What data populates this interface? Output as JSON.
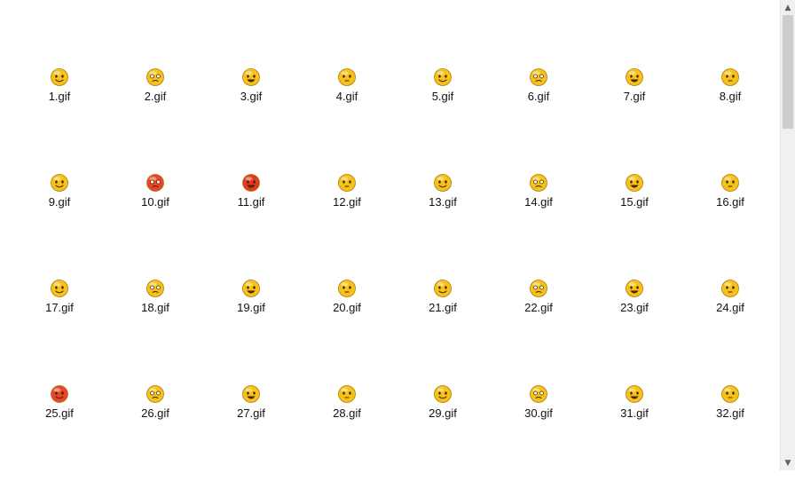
{
  "files": [
    {
      "name": "1.gif",
      "icon": "smiley-tongue-wink-icon",
      "face": "#f6c21a"
    },
    {
      "name": "2.gif",
      "icon": "smiley-worried-icon",
      "face": "#f6c21a"
    },
    {
      "name": "3.gif",
      "icon": "smiley-heart-eyes-icon",
      "face": "#f6c21a"
    },
    {
      "name": "4.gif",
      "icon": "smiley-grin-icon",
      "face": "#f6c21a"
    },
    {
      "name": "5.gif",
      "icon": "smiley-sunglasses-icon",
      "face": "#f6c21a"
    },
    {
      "name": "6.gif",
      "icon": "smiley-shy-icon",
      "face": "#f6c21a"
    },
    {
      "name": "7.gif",
      "icon": "smiley-surprised-icon",
      "face": "#f6c21a"
    },
    {
      "name": "8.gif",
      "icon": "smiley-sleepy-icon",
      "face": "#f6c21a"
    },
    {
      "name": "9.gif",
      "icon": "smiley-crying-icon",
      "face": "#f6c21a"
    },
    {
      "name": "10.gif",
      "icon": "smiley-embarrassed-icon",
      "face": "#e8452c"
    },
    {
      "name": "11.gif",
      "icon": "smiley-angry-icon",
      "face": "#e03a22"
    },
    {
      "name": "12.gif",
      "icon": "smiley-smile-icon",
      "face": "#f6c21a"
    },
    {
      "name": "13.gif",
      "icon": "smiley-big-teeth-icon",
      "face": "#f6c21a"
    },
    {
      "name": "14.gif",
      "icon": "smiley-happy-icon",
      "face": "#f6c21a"
    },
    {
      "name": "15.gif",
      "icon": "smiley-sad-icon",
      "face": "#f6c21a"
    },
    {
      "name": "16.gif",
      "icon": "smiley-cool-icon",
      "face": "#f6c21a"
    },
    {
      "name": "17.gif",
      "icon": "smiley-laugh-cry-icon",
      "face": "#f6c21a"
    },
    {
      "name": "18.gif",
      "icon": "smiley-dizzy-icon",
      "face": "#f6c21a"
    },
    {
      "name": "19.gif",
      "icon": "smiley-cover-mouth-icon",
      "face": "#f6c21a"
    },
    {
      "name": "20.gif",
      "icon": "smiley-blush-icon",
      "face": "#f6c21a"
    },
    {
      "name": "21.gif",
      "icon": "smiley-shout-icon",
      "face": "#f6c21a"
    },
    {
      "name": "22.gif",
      "icon": "smiley-thinking-icon",
      "face": "#f6c21a"
    },
    {
      "name": "23.gif",
      "icon": "smiley-annoyed-icon",
      "face": "#f6c21a"
    },
    {
      "name": "24.gif",
      "icon": "smiley-blank-icon",
      "face": "#f6c21a"
    },
    {
      "name": "25.gif",
      "icon": "smiley-rage-icon",
      "face": "#e8452c"
    },
    {
      "name": "26.gif",
      "icon": "smiley-squint-icon",
      "face": "#f6c21a"
    },
    {
      "name": "27.gif",
      "icon": "smiley-laugh-icon",
      "face": "#f6c21a"
    },
    {
      "name": "28.gif",
      "icon": "smiley-soldier-icon",
      "face": "#f6c21a"
    },
    {
      "name": "29.gif",
      "icon": "smiley-headband-icon",
      "face": "#f6c21a"
    },
    {
      "name": "30.gif",
      "icon": "smiley-confused-icon",
      "face": "#f6c21a"
    },
    {
      "name": "31.gif",
      "icon": "smiley-shocked-icon",
      "face": "#f6c21a"
    },
    {
      "name": "32.gif",
      "icon": "smiley-stunned-icon",
      "face": "#f6c21a"
    }
  ],
  "scrollbar": {
    "up_arrow": "▲",
    "down_arrow": "▼"
  }
}
